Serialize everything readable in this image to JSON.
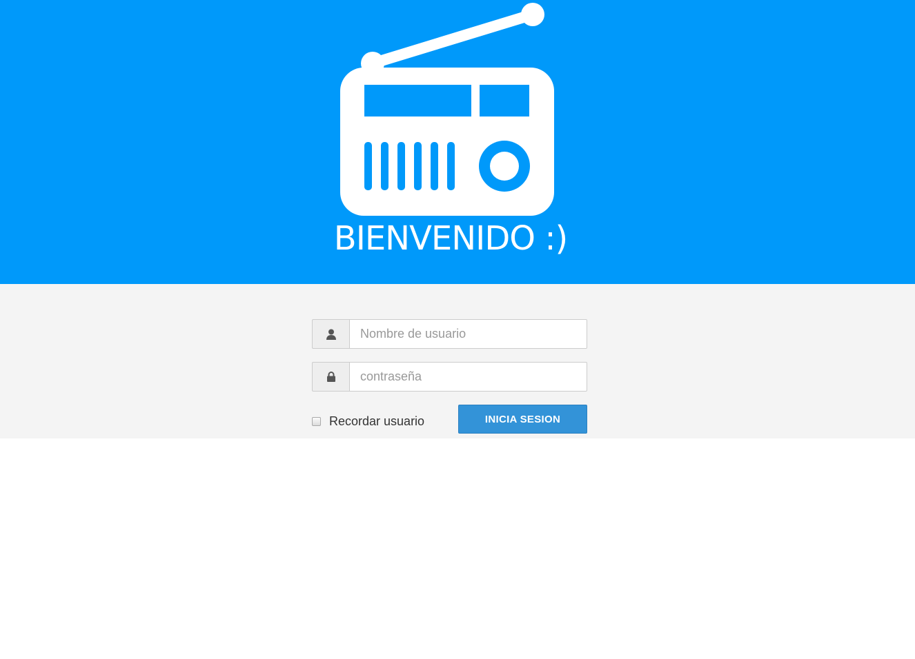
{
  "header": {
    "logo_icon": "radio-icon",
    "welcome_text": "BIENVENIDO :)",
    "background_color": "#0099fa"
  },
  "login": {
    "username": {
      "icon": "user-icon",
      "value": "",
      "placeholder": "Nombre de usuario"
    },
    "password": {
      "icon": "lock-icon",
      "value": "",
      "placeholder": "contraseña"
    },
    "remember": {
      "label": "Recordar usuario",
      "checked": false
    },
    "submit_label": "INICIA SESION",
    "button_color": "#3393d8"
  }
}
